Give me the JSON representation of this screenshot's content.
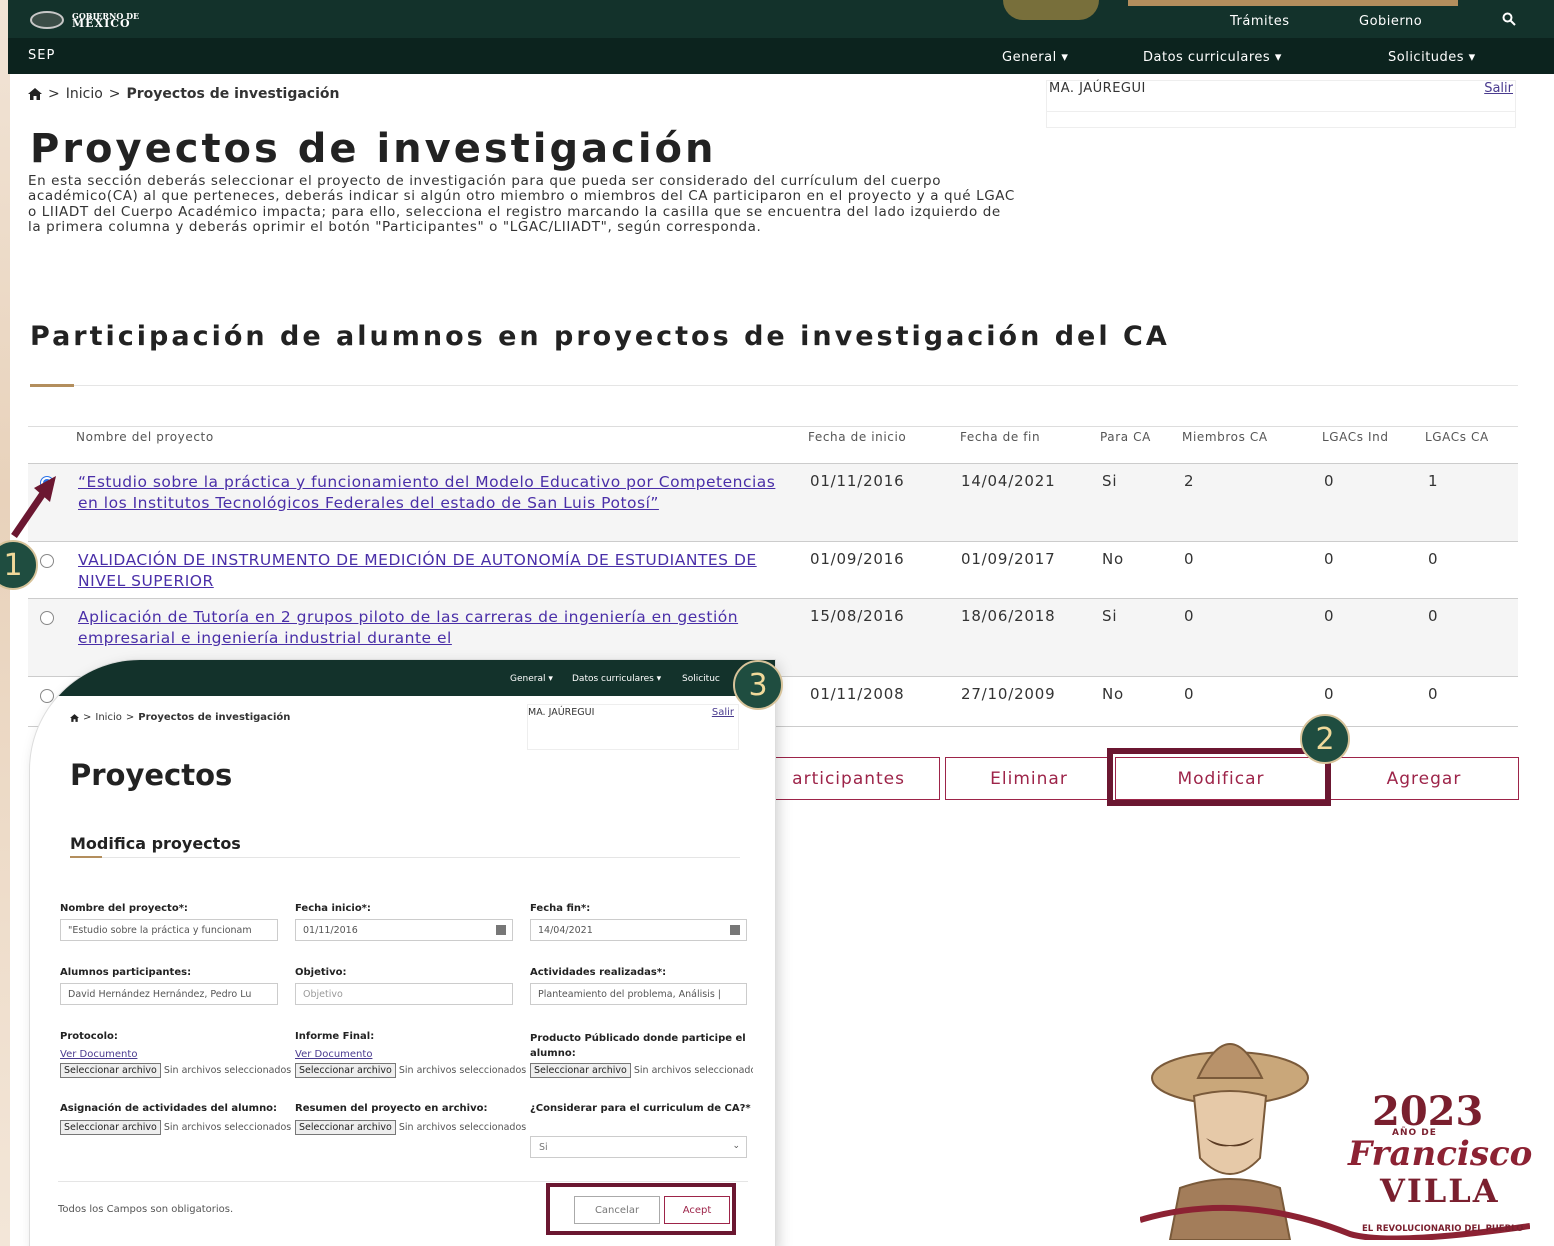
{
  "header": {
    "gov_logo_small": "GOBIERNO DE",
    "gov_logo_big": "MÉXICO",
    "links": [
      "Trámites",
      "Gobierno"
    ],
    "sep_title": "SEP",
    "nav": [
      "General ▾",
      "Datos curriculares ▾",
      "Solicitudes ▾"
    ]
  },
  "breadcrumb": {
    "separator": ">",
    "home": "Inicio",
    "current": "Proyectos de investigación"
  },
  "user": {
    "name": "MA. JAÚREGUI",
    "logout": "Salir"
  },
  "page": {
    "title": "Proyectos de investigación",
    "intro": "En esta sección deberás seleccionar el proyecto de investigación para que pueda ser considerado del currículum del cuerpo académico(CA) al que perteneces, deberás indicar si algún otro miembro o miembros del CA participaron en el proyecto y a qué LGAC o LIIADT del Cuerpo Académico impacta; para ello, selecciona el registro marcando la casilla que se encuentra del lado izquierdo de la primera columna y deberás oprimir el botón \"Participantes\" o \"LGAC/LIIADT\", según corresponda.",
    "section_title": "Participación de alumnos en proyectos de investigación del CA"
  },
  "table": {
    "headers": [
      "Nombre del proyecto",
      "Fecha de inicio",
      "Fecha de fin",
      "Para CA",
      "Miembros CA",
      "LGACs Ind",
      "LGACs CA"
    ],
    "rows": [
      {
        "name": "“Estudio sobre la práctica y funcionamiento del Modelo Educativo por Competencias en los Institutos Tecnológicos Federales del estado de San Luis Potosí”",
        "inicio": "01/11/2016",
        "fin": "14/04/2021",
        "para_ca": "Si",
        "miembros": "2",
        "lgac_ind": "0",
        "lgac_ca": "1",
        "selected": true
      },
      {
        "name": "VALIDACIÓN DE INSTRUMENTO DE MEDICIÓN DE AUTONOMÍA DE ESTUDIANTES DE NIVEL SUPERIOR",
        "inicio": "01/09/2016",
        "fin": "01/09/2017",
        "para_ca": "No",
        "miembros": "0",
        "lgac_ind": "0",
        "lgac_ca": "0",
        "selected": false
      },
      {
        "name": "Aplicación de Tutoría en 2 grupos piloto de las carreras de ingeniería en gestión empresarial e ingeniería industrial durante el",
        "inicio": "15/08/2016",
        "fin": "18/06/2018",
        "para_ca": "Si",
        "miembros": "0",
        "lgac_ind": "0",
        "lgac_ca": "0",
        "selected": false
      },
      {
        "name": "",
        "inicio": "01/11/2008",
        "fin": "27/10/2009",
        "para_ca": "No",
        "miembros": "0",
        "lgac_ind": "0",
        "lgac_ca": "0",
        "selected": false
      }
    ]
  },
  "actions": {
    "participantes": "articipantes",
    "eliminar": "Eliminar",
    "modificar": "Modificar",
    "agregar": "Agregar"
  },
  "steps": [
    "1",
    "2",
    "3"
  ],
  "modal": {
    "nav": [
      "General ▾",
      "Datos curriculares ▾",
      "Solicituc"
    ],
    "breadcrumb_home": "Inicio",
    "breadcrumb_current": "Proyectos de investigación",
    "user": "MA. JAÚREGUI",
    "logout": "Salir",
    "title": "Proyectos",
    "subtitle": "Modifica proyectos",
    "fields": {
      "nombre_label": "Nombre del proyecto*:",
      "nombre_value": "\"Estudio sobre la práctica y funcionam",
      "fecha_inicio_label": "Fecha inicio*:",
      "fecha_inicio_value": "01/11/2016",
      "fecha_fin_label": "Fecha fin*:",
      "fecha_fin_value": "14/04/2021",
      "alumnos_label": "Alumnos participantes:",
      "alumnos_value": "David Hernández Hernández, Pedro Lu",
      "objetivo_label": "Objetivo:",
      "objetivo_placeholder": "Objetivo",
      "actividades_label": "Actividades realizadas*:",
      "actividades_value": "Planteamiento del problema, Análisis |",
      "protocolo_label": "Protocolo:",
      "informe_label": "Informe Final:",
      "producto_label": "Producto Públicado donde participe el alumno:",
      "ver_documento": "Ver Documento",
      "file_button": "Seleccionar archivo",
      "file_none": "Sin archivos seleccionados",
      "asignacion_label": "Asignación de actividades del alumno:",
      "resumen_label": "Resumen del proyecto en archivo:",
      "considerar_label": "¿Considerar para el curriculum de CA?*",
      "considerar_value": "Si"
    },
    "footnote": "Todos los Campos son obligatorios.",
    "cancel": "Cancelar",
    "accept": "Acept"
  },
  "villa": {
    "year": "2023",
    "anio_de": "AÑO DE",
    "name1": "Francisco",
    "name2": "VILLA",
    "motto": "EL REVOLUCIONARIO DEL PUEBLO"
  },
  "colors": {
    "gov_green": "#13322b",
    "accent_wine": "#9d2449",
    "badge_green": "#1f4d40",
    "gold": "#b38e5d"
  }
}
